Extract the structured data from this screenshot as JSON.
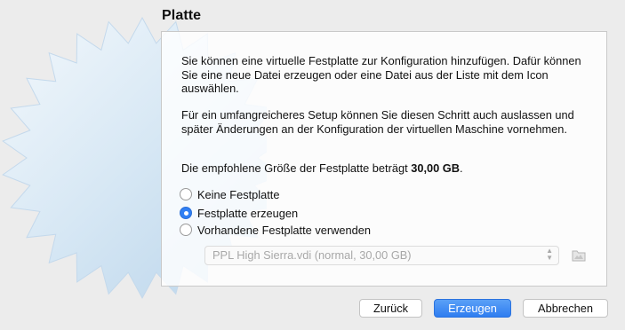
{
  "section_title": "Platte",
  "paragraphs": {
    "p1": "Sie können eine virtuelle Festplatte zur Konfiguration hinzufügen. Dafür können Sie eine neue Datei erzeugen oder eine Datei aus der Liste mit dem Icon auswählen.",
    "p2": "Für ein umfangreicheres Setup können Sie diesen Schritt auch auslassen und später Änderungen an der Konfiguration der virtuellen Maschine vornehmen.",
    "p3_prefix": "Die empfohlene Größe der Festplatte beträgt ",
    "p3_size": "30,00 GB",
    "p3_suffix": "."
  },
  "options": {
    "none": "Keine Festplatte",
    "create": "Festplatte erzeugen",
    "existing": "Vorhandene Festplatte verwenden",
    "selected": "create"
  },
  "disk_select": {
    "value": "PPL High Sierra.vdi (normal, 30,00 GB)",
    "enabled": false
  },
  "icons": {
    "disk_chooser": "folder-icon",
    "select_arrows": "updown-chevron-icon"
  },
  "buttons": {
    "back": "Zurück",
    "create": "Erzeugen",
    "cancel": "Abbrechen"
  },
  "colors": {
    "accent": "#2f7ff4",
    "window_bg": "#ececec"
  }
}
